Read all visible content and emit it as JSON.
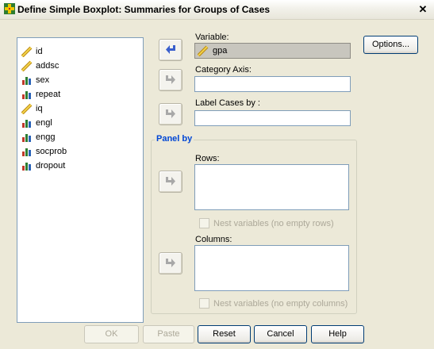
{
  "window": {
    "title": "Define Simple Boxplot: Summaries for Groups of Cases",
    "close_label": "✕"
  },
  "variables": [
    {
      "name": "id",
      "type": "scale"
    },
    {
      "name": "addsc",
      "type": "scale"
    },
    {
      "name": "sex",
      "type": "nominal"
    },
    {
      "name": "repeat",
      "type": "nominal"
    },
    {
      "name": "iq",
      "type": "scale"
    },
    {
      "name": "engl",
      "type": "nominal"
    },
    {
      "name": "engg",
      "type": "nominal"
    },
    {
      "name": "socprob",
      "type": "nominal"
    },
    {
      "name": "dropout",
      "type": "nominal"
    }
  ],
  "fields": {
    "variable_label": "Variable:",
    "variable_value": "gpa",
    "category_axis_label": "Category Axis:",
    "category_axis_value": "",
    "label_cases_label": "Label Cases by :",
    "label_cases_value": ""
  },
  "panel": {
    "title": "Panel by",
    "rows_label": "Rows:",
    "nest_rows_label": "Nest variables (no empty rows)",
    "columns_label": "Columns:",
    "nest_columns_label": "Nest variables (no empty columns)"
  },
  "buttons": {
    "options": "Options...",
    "ok": "OK",
    "paste": "Paste",
    "reset": "Reset",
    "cancel": "Cancel",
    "help": "Help"
  },
  "colors": {
    "arrow_active": "#3A5FCD",
    "arrow_inactive": "#A8A8A8",
    "panel_title": "#0046D5"
  }
}
